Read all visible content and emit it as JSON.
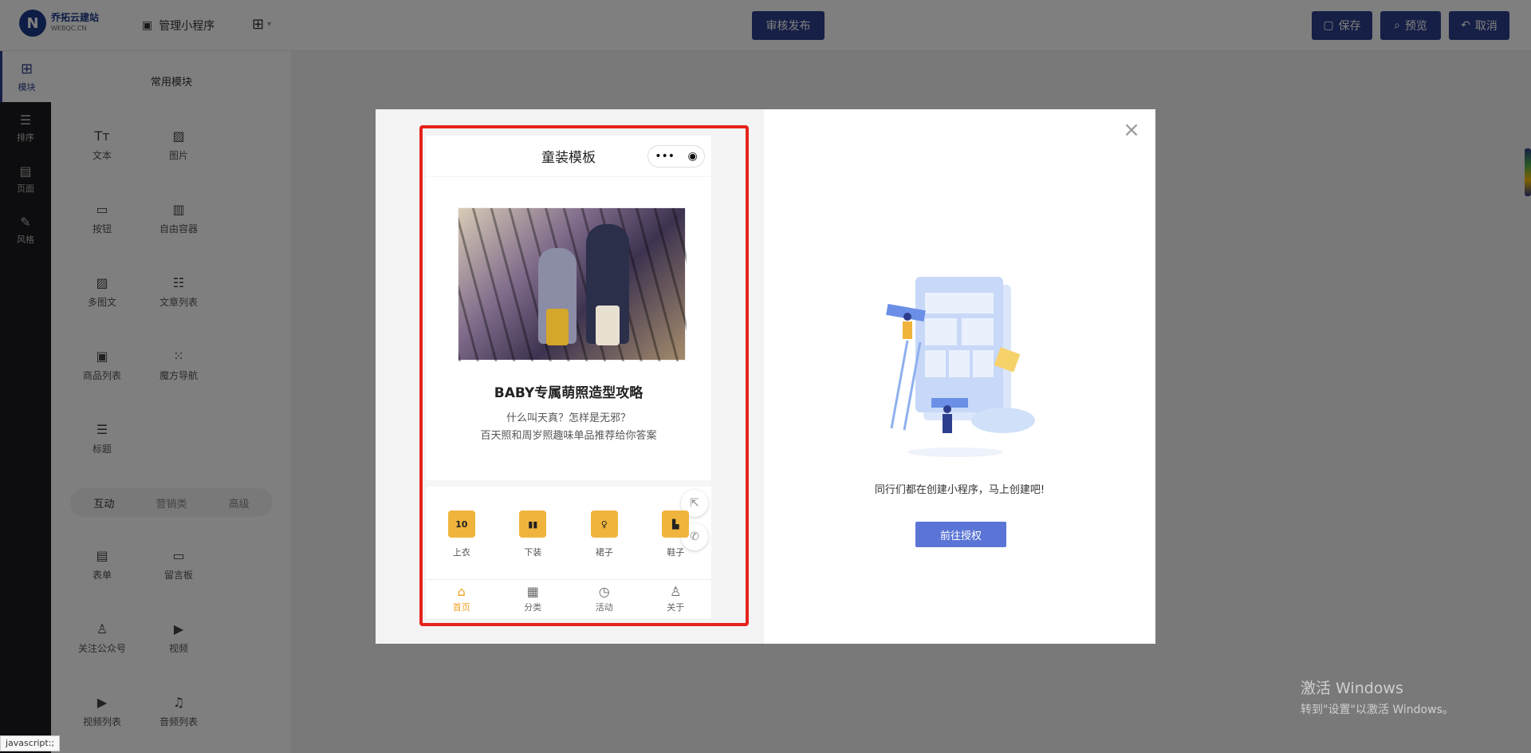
{
  "topbar": {
    "logo_name": "乔拓云建站",
    "logo_url": "WEBQC.CN",
    "logo_letter": "N",
    "manage_label": "管理小程序",
    "publish_label": "审核发布",
    "save_label": "保存",
    "preview_label": "预览",
    "cancel_label": "取消"
  },
  "rail": {
    "items": [
      {
        "label": "模块",
        "icon": "plus-square-icon"
      },
      {
        "label": "排序",
        "icon": "sort-icon"
      },
      {
        "label": "页面",
        "icon": "pages-icon"
      },
      {
        "label": "风格",
        "icon": "magic-wand-icon"
      }
    ]
  },
  "panel": {
    "title": "常用模块",
    "components": [
      {
        "label": "文本",
        "icon": "text-icon"
      },
      {
        "label": "图片",
        "icon": "image-icon"
      },
      {
        "label": "按钮",
        "icon": "button-icon"
      },
      {
        "label": "自由容器",
        "icon": "container-icon"
      },
      {
        "label": "多图文",
        "icon": "multi-image-icon"
      },
      {
        "label": "文章列表",
        "icon": "article-list-icon"
      },
      {
        "label": "商品列表",
        "icon": "product-list-icon"
      },
      {
        "label": "魔方导航",
        "icon": "grid-nav-icon"
      },
      {
        "label": "标题",
        "icon": "title-icon"
      }
    ],
    "tabs": [
      "互动",
      "营销类",
      "高级"
    ],
    "components2": [
      {
        "label": "表单",
        "icon": "form-icon"
      },
      {
        "label": "留言板",
        "icon": "message-board-icon"
      },
      {
        "label": "关注公众号",
        "icon": "follow-icon"
      },
      {
        "label": "视频",
        "icon": "video-icon"
      },
      {
        "label": "视频列表",
        "icon": "video-list-icon"
      },
      {
        "label": "音频列表",
        "icon": "audio-list-icon"
      }
    ]
  },
  "modal": {
    "phone_title": "童装模板",
    "capsule_more": "•••",
    "capsule_close": "◉",
    "article_title": "BABY专属萌照造型攻略",
    "article_line1": "什么叫天真？怎样是无邪？",
    "article_line2": "百天照和周岁照趣味单品推荐给你答案",
    "categories": [
      {
        "label": "上衣",
        "icon": "shirt-icon",
        "glyph": "10"
      },
      {
        "label": "下装",
        "icon": "pants-icon",
        "glyph": "▮▮"
      },
      {
        "label": "裙子",
        "icon": "dress-icon",
        "glyph": "♀"
      },
      {
        "label": "鞋子",
        "icon": "shoe-icon",
        "glyph": "▙"
      }
    ],
    "tabbar": [
      {
        "label": "首页",
        "icon": "home-icon",
        "glyph": "⌂"
      },
      {
        "label": "分类",
        "icon": "category-icon",
        "glyph": "▦"
      },
      {
        "label": "活动",
        "icon": "clock-icon",
        "glyph": "◷"
      },
      {
        "label": "关于",
        "icon": "user-icon",
        "glyph": "♙"
      }
    ],
    "tip": "同行们都在创建小程序，马上创建吧!",
    "auth_button": "前往授权",
    "close": "×"
  },
  "windows": {
    "line1": "激活 Windows",
    "line2": "转到\"设置\"以激活 Windows。"
  },
  "statusbar": "javascript:;",
  "colors": {
    "primary": "#2d3e8c",
    "auth": "#5a75d6",
    "highlight": "#e5231b",
    "accent": "#f0a020"
  }
}
